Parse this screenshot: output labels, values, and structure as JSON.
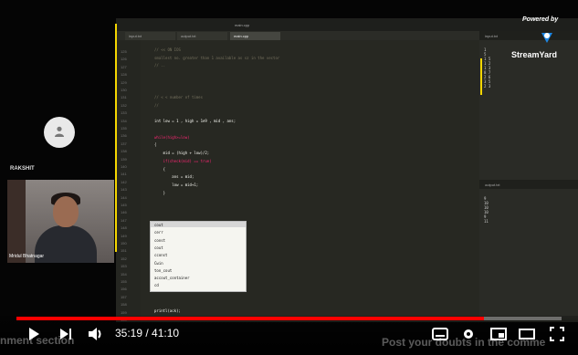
{
  "participants": {
    "speaker_name": "RAKSHIT",
    "camera_label": "Mridul Bhatnagar"
  },
  "editor": {
    "window_title": "main.cpp",
    "tabs": [
      "main.cpp",
      "input.txt",
      "output.txt"
    ],
    "line_numbers": [
      "125",
      "126",
      "127",
      "128",
      "129",
      "130",
      "131",
      "132",
      "133",
      "134",
      "135",
      "136",
      "137",
      "138",
      "139",
      "140",
      "141",
      "142",
      "143",
      "144",
      "145",
      "146",
      "147",
      "148",
      "149",
      "150",
      "151",
      "152",
      "153",
      "154",
      "155",
      "156",
      "157",
      "158",
      "159",
      "160"
    ],
    "code_lines": [
      {
        "text": "// << ON IOS",
        "cls": "comment"
      },
      {
        "text": "smallest no. greater than 1 available as sz in the vector",
        "cls": "comment"
      },
      {
        "text": "// ..",
        "cls": "comment"
      },
      {
        "text": "",
        "cls": "plain"
      },
      {
        "text": "",
        "cls": "plain"
      },
      {
        "text": "",
        "cls": "plain"
      },
      {
        "text": "// < < number of times",
        "cls": "comment"
      },
      {
        "text": "//",
        "cls": "comment"
      },
      {
        "text": "",
        "cls": "plain"
      },
      {
        "text": "int low = 1 , high = 1e9 , mid , ans;",
        "cls": "plain"
      },
      {
        "text": "",
        "cls": "plain"
      },
      {
        "text": "while(high>=low)",
        "cls": "kw"
      },
      {
        "text": "{",
        "cls": "plain"
      },
      {
        "text": "    mid = (high + low)/2;",
        "cls": "plain"
      },
      {
        "text": "    if(check(mid) == true)",
        "cls": "kw"
      },
      {
        "text": "    {",
        "cls": "plain"
      },
      {
        "text": "        ans = mid;",
        "cls": "plain"
      },
      {
        "text": "        low = mid+1;",
        "cls": "plain"
      },
      {
        "text": "    }",
        "cls": "plain"
      }
    ],
    "print_line": "printl(ack);",
    "autocomplete": [
      "cout",
      "cerr",
      "const",
      "cout",
      "cconst",
      "Cwin",
      "ton_cout",
      "accout_container",
      "cd"
    ]
  },
  "panels": {
    "top_tab": "input.txt",
    "top_lines": "1\n5\n1 5\n1 2\n1 3\n8 7\n2 6\n3 5\n2 3",
    "bottom_tab": "output.txt",
    "bottom_lines": "9\n10\n10\n10\n9\n11"
  },
  "branding": {
    "powered": "Powered by",
    "logo": "StreamYard"
  },
  "player": {
    "current_time": "35:19",
    "duration": "41:10",
    "progress": 0.858,
    "overlay_left": "nment section",
    "overlay_right": "Post your doubts in the comme"
  }
}
